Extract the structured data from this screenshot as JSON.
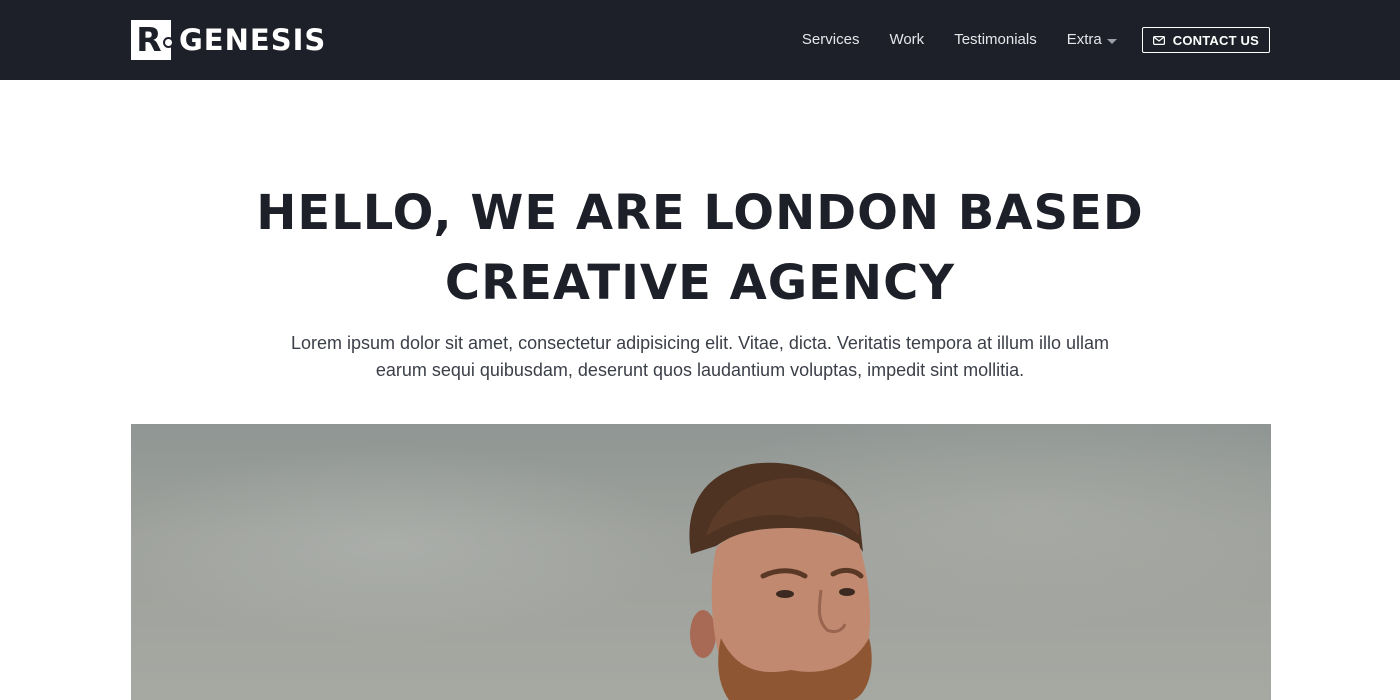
{
  "brand": {
    "mark_letter": "R",
    "name": "GENESIS"
  },
  "nav": {
    "items": [
      {
        "label": "Services"
      },
      {
        "label": "Work"
      },
      {
        "label": "Testimonials"
      },
      {
        "label": "Extra",
        "has_dropdown": true
      }
    ],
    "contact_label": "CONTACT US"
  },
  "hero": {
    "title_line1": "HELLO, WE ARE LONDON BASED",
    "title_line2": "CREATIVE AGENCY",
    "subtitle_line1": "Lorem ipsum dolor sit amet, consectetur adipisicing elit. Vitae, dicta. Veritatis tempora at illum illo ullam",
    "subtitle_line2": "earum sequi quibusdam, deserunt quos laudantium voluptas, impedit sint mollitia."
  },
  "icons": {
    "contact": "envelope-icon",
    "dropdown": "caret-down-icon"
  },
  "colors": {
    "header_bg": "#1d2029",
    "heading": "#1d2029",
    "body_text": "#3b3f48",
    "nav_text": "#e4e6ea"
  }
}
